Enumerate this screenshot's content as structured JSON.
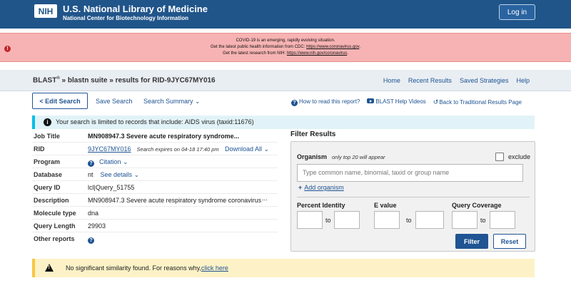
{
  "header": {
    "logo": "NIH",
    "title": "U.S. National Library of Medicine",
    "subtitle": "National Center for Biotechnology Information",
    "login_label": "Log in"
  },
  "covid_banner": {
    "line1": "COVID-19 is an emerging, rapidly evolving situation.",
    "line2_text": "Get the latest public health information from CDC: ",
    "line2_link": "https://www.coronavirus.gov",
    "line2_tail": ".",
    "line3_text": "Get the latest research from NIH: ",
    "line3_link": "https://www.nih.gov/coronavirus",
    "line3_tail": ".",
    "icon": "!"
  },
  "breadcrumb": {
    "blast": "BLAST",
    "registered": "®",
    "rest": " » blastn suite » results for RID-9JYC67MY016"
  },
  "topnav": [
    "Home",
    "Recent Results",
    "Saved Strategies",
    "Help"
  ],
  "toolbar": {
    "edit_label": "< Edit Search",
    "save_label": "Save Search",
    "summary_label": "Search Summary",
    "how_to_read": "How to read this report?",
    "help_videos": "BLAST Help Videos",
    "back_traditional": "Back to Traditional Results Page"
  },
  "info_banner": {
    "icon": "i",
    "text": "Your search is limited to records that include: AIDS virus (taxid:11676)"
  },
  "details": {
    "job_title_label": "Job Title",
    "job_title_value": "MN908947.3 Severe acute respiratory syndrome...",
    "rid_label": "RID",
    "rid_value": "9JYC67MY016",
    "rid_expires": "Search expires on 04-18 17:40 pm",
    "download_all": "Download All",
    "program_label": "Program",
    "citation": "Citation",
    "database_label": "Database",
    "database_value": "nt",
    "see_details": "See details",
    "query_id_label": "Query ID",
    "query_id_value": "lcl|Query_51755",
    "description_label": "Description",
    "description_value": "MN908947.3 Severe acute respiratory syndrome coronavirus",
    "description_more": "...",
    "molecule_label": "Molecule type",
    "molecule_value": "dna",
    "length_label": "Query Length",
    "length_value": "29903",
    "other_label": "Other reports"
  },
  "filter": {
    "title": "Filter Results",
    "organism_label": "Organism",
    "organism_note": "only top 20 will appear",
    "exclude_label": "exclude",
    "organism_placeholder": "Type common name, binomial, taxid or group name",
    "add_organism": "Add organism",
    "percent_identity": "Percent Identity",
    "e_value": "E value",
    "query_coverage": "Query Coverage",
    "to": "to",
    "filter_btn": "Filter",
    "reset_btn": "Reset"
  },
  "warning": {
    "text": "No significant similarity found. For reasons why,",
    "link": "click here"
  }
}
